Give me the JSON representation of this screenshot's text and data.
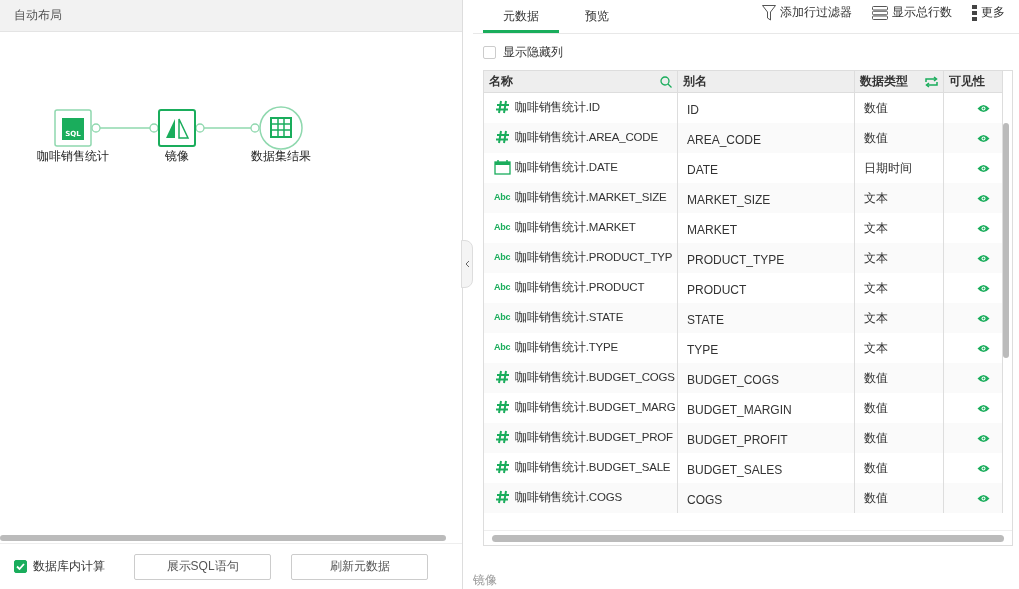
{
  "left_panel": {
    "title": "自动布局",
    "flow": {
      "nodes": [
        {
          "label": "咖啡销售统计",
          "kind": "sql",
          "selected": false,
          "icon_text": "SQL"
        },
        {
          "label": "镜像",
          "kind": "mirror",
          "selected": true
        },
        {
          "label": "数据集结果",
          "kind": "result",
          "selected": false
        }
      ]
    },
    "in_database": {
      "label": "数据库内计算",
      "checked": true
    },
    "buttons": [
      "展示SQL语句",
      "刷新元数据"
    ]
  },
  "right_panel": {
    "tabs": [
      {
        "label": "元数据",
        "selected": true
      },
      {
        "label": "预览",
        "selected": false
      }
    ],
    "actions": [
      {
        "label": "添加行过滤器",
        "kind": "filter"
      },
      {
        "label": "显示总行数",
        "kind": "rows"
      },
      {
        "label": "更多",
        "kind": "more"
      }
    ],
    "show_hidden": {
      "label": "显示隐藏列",
      "checked": false
    },
    "table": {
      "columns": [
        "名称",
        "别名",
        "数据类型",
        "可见性"
      ],
      "rows": [
        {
          "kind": "number",
          "name": "咖啡销售统计.ID",
          "alias": "ID",
          "type": "数值",
          "visible": true
        },
        {
          "kind": "number",
          "name": "咖啡销售统计.AREA_CODE",
          "alias": "AREA_CODE",
          "type": "数值",
          "visible": true
        },
        {
          "kind": "date",
          "name": "咖啡销售统计.DATE",
          "alias": "DATE",
          "type": "日期时间",
          "visible": true
        },
        {
          "kind": "text",
          "icon_text": "Abc",
          "name": "咖啡销售统计.MARKET_SIZE",
          "alias": "MARKET_SIZE",
          "type": "文本",
          "visible": true
        },
        {
          "kind": "text",
          "icon_text": "Abc",
          "name": "咖啡销售统计.MARKET",
          "alias": "MARKET",
          "type": "文本",
          "visible": true
        },
        {
          "kind": "text",
          "icon_text": "Abc",
          "name": "咖啡销售统计.PRODUCT_TYP",
          "alias": "PRODUCT_TYPE",
          "type": "文本",
          "visible": true
        },
        {
          "kind": "text",
          "icon_text": "Abc",
          "name": "咖啡销售统计.PRODUCT",
          "alias": "PRODUCT",
          "type": "文本",
          "visible": true
        },
        {
          "kind": "text",
          "icon_text": "Abc",
          "name": "咖啡销售统计.STATE",
          "alias": "STATE",
          "type": "文本",
          "visible": true
        },
        {
          "kind": "text",
          "icon_text": "Abc",
          "name": "咖啡销售统计.TYPE",
          "alias": "TYPE",
          "type": "文本",
          "visible": true
        },
        {
          "kind": "number",
          "name": "咖啡销售统计.BUDGET_COGS",
          "alias": "BUDGET_COGS",
          "type": "数值",
          "visible": true
        },
        {
          "kind": "number",
          "name": "咖啡销售统计.BUDGET_MARG",
          "alias": "BUDGET_MARGIN",
          "type": "数值",
          "visible": true
        },
        {
          "kind": "number",
          "name": "咖啡销售统计.BUDGET_PROF",
          "alias": "BUDGET_PROFIT",
          "type": "数值",
          "visible": true
        },
        {
          "kind": "number",
          "name": "咖啡销售统计.BUDGET_SALE",
          "alias": "BUDGET_SALES",
          "type": "数值",
          "visible": true
        },
        {
          "kind": "number",
          "name": "咖啡销售统计.COGS",
          "alias": "COGS",
          "type": "数值",
          "visible": true
        }
      ]
    },
    "node_label": "镜像"
  }
}
